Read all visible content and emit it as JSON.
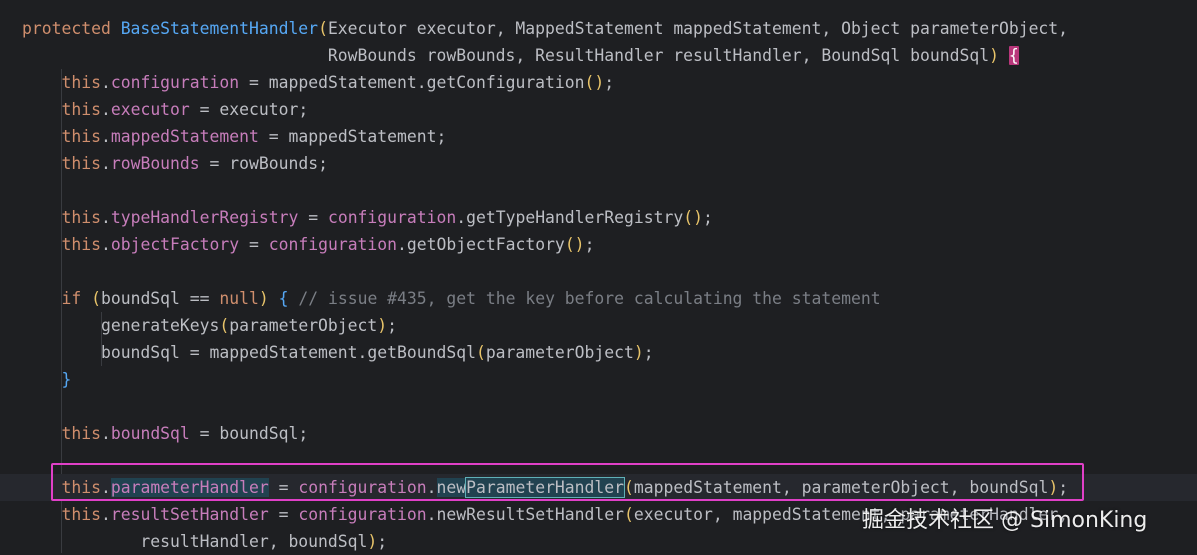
{
  "editor": {
    "lines": [
      {
        "indent": "",
        "tokens": [
          {
            "t": "protected ",
            "c": "kw"
          },
          {
            "t": "BaseStatementHandler",
            "c": "fn"
          },
          {
            "t": "(",
            "c": "paren"
          },
          {
            "t": "Executor executor, MappedStatement mappedStatement, Object parameterObject,",
            "c": ""
          }
        ]
      },
      {
        "indent": "                               ",
        "tokens": [
          {
            "t": "RowBounds rowBounds, ResultHandler resultHandler, BoundSql boundSql",
            "c": ""
          },
          {
            "t": ")",
            "c": "paren"
          },
          {
            "t": " ",
            "c": ""
          },
          {
            "t": "{",
            "c": "brace-hl"
          }
        ]
      },
      {
        "indent": "    ",
        "tokens": [
          {
            "t": "this",
            "c": "kw"
          },
          {
            "t": ".",
            "c": ""
          },
          {
            "t": "configuration",
            "c": "fld"
          },
          {
            "t": " = mappedStatement.getConfiguration",
            "c": ""
          },
          {
            "t": "()",
            "c": "paren"
          },
          {
            "t": ";",
            "c": ""
          }
        ]
      },
      {
        "indent": "    ",
        "tokens": [
          {
            "t": "this",
            "c": "kw"
          },
          {
            "t": ".",
            "c": ""
          },
          {
            "t": "executor",
            "c": "fld"
          },
          {
            "t": " = executor;",
            "c": ""
          }
        ]
      },
      {
        "indent": "    ",
        "tokens": [
          {
            "t": "this",
            "c": "kw"
          },
          {
            "t": ".",
            "c": ""
          },
          {
            "t": "mappedStatement",
            "c": "fld"
          },
          {
            "t": " = mappedStatement;",
            "c": ""
          }
        ]
      },
      {
        "indent": "    ",
        "tokens": [
          {
            "t": "this",
            "c": "kw"
          },
          {
            "t": ".",
            "c": ""
          },
          {
            "t": "rowBounds",
            "c": "fld"
          },
          {
            "t": " = rowBounds;",
            "c": ""
          }
        ]
      },
      {
        "indent": "",
        "tokens": []
      },
      {
        "indent": "    ",
        "tokens": [
          {
            "t": "this",
            "c": "kw"
          },
          {
            "t": ".",
            "c": ""
          },
          {
            "t": "typeHandlerRegistry",
            "c": "fld"
          },
          {
            "t": " = ",
            "c": ""
          },
          {
            "t": "configuration",
            "c": "fld"
          },
          {
            "t": ".getTypeHandlerRegistry",
            "c": ""
          },
          {
            "t": "()",
            "c": "paren"
          },
          {
            "t": ";",
            "c": ""
          }
        ]
      },
      {
        "indent": "    ",
        "tokens": [
          {
            "t": "this",
            "c": "kw"
          },
          {
            "t": ".",
            "c": ""
          },
          {
            "t": "objectFactory",
            "c": "fld"
          },
          {
            "t": " = ",
            "c": ""
          },
          {
            "t": "configuration",
            "c": "fld"
          },
          {
            "t": ".getObjectFactory",
            "c": ""
          },
          {
            "t": "()",
            "c": "paren"
          },
          {
            "t": ";",
            "c": ""
          }
        ]
      },
      {
        "indent": "",
        "tokens": []
      },
      {
        "indent": "    ",
        "tokens": [
          {
            "t": "if ",
            "c": "kw"
          },
          {
            "t": "(",
            "c": "paren"
          },
          {
            "t": "boundSql == ",
            "c": ""
          },
          {
            "t": "null",
            "c": "kw"
          },
          {
            "t": ")",
            "c": "paren"
          },
          {
            "t": " ",
            "c": ""
          },
          {
            "t": "{",
            "c": "brace-b"
          },
          {
            "t": " // issue #435, get the key before calculating the statement",
            "c": "cm"
          }
        ]
      },
      {
        "indent": "        ",
        "tokens": [
          {
            "t": "generateKeys",
            "c": ""
          },
          {
            "t": "(",
            "c": "paren"
          },
          {
            "t": "parameterObject",
            "c": ""
          },
          {
            "t": ")",
            "c": "paren"
          },
          {
            "t": ";",
            "c": ""
          }
        ]
      },
      {
        "indent": "        ",
        "tokens": [
          {
            "t": "boundSql = mappedStatement.getBoundSql",
            "c": ""
          },
          {
            "t": "(",
            "c": "paren"
          },
          {
            "t": "parameterObject",
            "c": ""
          },
          {
            "t": ")",
            "c": "paren"
          },
          {
            "t": ";",
            "c": ""
          }
        ]
      },
      {
        "indent": "    ",
        "tokens": [
          {
            "t": "}",
            "c": "brace-b"
          }
        ]
      },
      {
        "indent": "",
        "tokens": []
      },
      {
        "indent": "    ",
        "tokens": [
          {
            "t": "this",
            "c": "kw"
          },
          {
            "t": ".",
            "c": ""
          },
          {
            "t": "boundSql",
            "c": "fld"
          },
          {
            "t": " = boundSql;",
            "c": ""
          }
        ]
      },
      {
        "indent": "",
        "tokens": []
      },
      {
        "indent": "    ",
        "current": true,
        "tokens": [
          {
            "t": "this",
            "c": "kw"
          },
          {
            "t": ".",
            "c": ""
          },
          {
            "t": "parameterHandler",
            "c": "fld ref-hl"
          },
          {
            "t": " = ",
            "c": ""
          },
          {
            "t": "configuration",
            "c": "fld"
          },
          {
            "t": ".",
            "c": ""
          },
          {
            "t": "new",
            "c": "ref-hl"
          },
          {
            "t": "ParameterHandler",
            "c": "ref-hl box-hl"
          },
          {
            "t": "(",
            "c": "paren"
          },
          {
            "t": "mappedStatement, parameterObject, boundSql",
            "c": ""
          },
          {
            "t": ")",
            "c": "paren"
          },
          {
            "t": ";",
            "c": ""
          }
        ]
      },
      {
        "indent": "    ",
        "tokens": [
          {
            "t": "this",
            "c": "kw"
          },
          {
            "t": ".",
            "c": ""
          },
          {
            "t": "resultSetHandler",
            "c": "fld"
          },
          {
            "t": " = ",
            "c": ""
          },
          {
            "t": "configuration",
            "c": "fld"
          },
          {
            "t": ".newResultSetHandler",
            "c": ""
          },
          {
            "t": "(",
            "c": "paren"
          },
          {
            "t": "executor, mappedStatement, parameterHandler,",
            "c": ""
          }
        ]
      },
      {
        "indent": "            ",
        "tokens": [
          {
            "t": "resultHandler, boundSql",
            "c": ""
          },
          {
            "t": ")",
            "c": "paren"
          },
          {
            "t": ";",
            "c": ""
          }
        ]
      }
    ]
  },
  "watermark": {
    "text": "掘金技术社区 @ SimonKing"
  },
  "colors": {
    "background": "#1e1f22",
    "keyword": "#cf8e6d",
    "function": "#56a8f5",
    "field": "#c77dbb",
    "comment": "#7a7e85",
    "highlight_box": "#e040c8"
  }
}
